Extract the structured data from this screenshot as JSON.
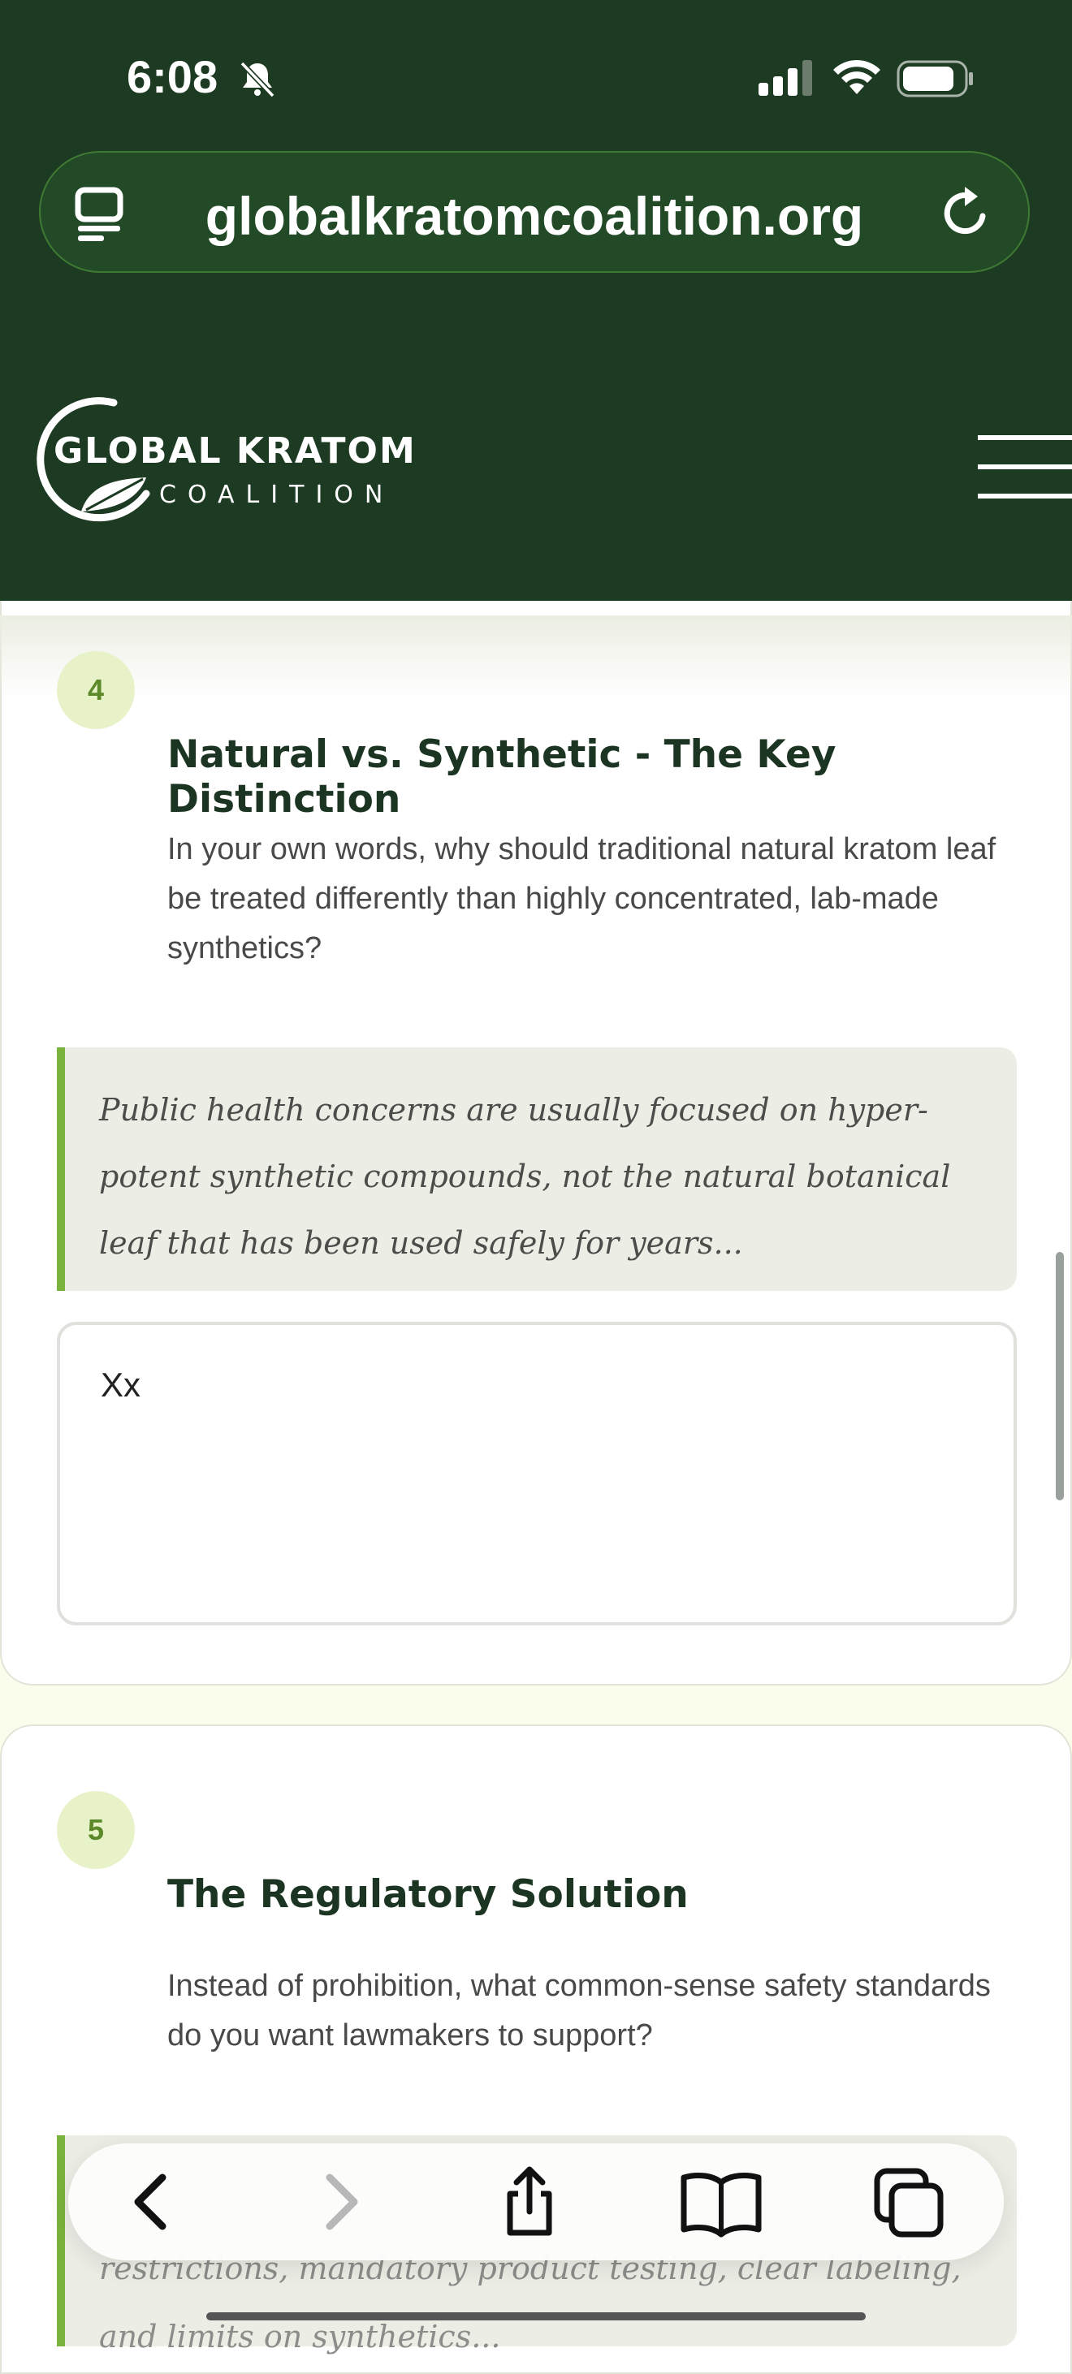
{
  "status_bar": {
    "time": "6:08"
  },
  "browser": {
    "url": "globalkratomcoalition.org"
  },
  "site": {
    "logo_line1": "GLOBAL KRATOM",
    "logo_line2": "COALITION"
  },
  "questions": [
    {
      "number": "4",
      "title": "Natural vs. Synthetic - The Key Distinction",
      "description": "In your own words, why should traditional natural kratom leaf be treated differently than highly concentrated, lab-made synthetics?",
      "example": "Public health concerns are usually focused on hyper-potent synthetic compounds, not the natural botanical leaf that has been used safely for years...",
      "answer": "Xx"
    },
    {
      "number": "5",
      "title": "The Regulatory Solution",
      "description": "Instead of prohibition, what common-sense safety standards do you want lawmakers to support?",
      "example": "restrictions, mandatory product testing, clear labeling, and limits on synthetics..."
    }
  ],
  "colors": {
    "header_bg": "#1d3a22",
    "accent_green": "#7ab33c",
    "title_text": "#1c3522"
  }
}
